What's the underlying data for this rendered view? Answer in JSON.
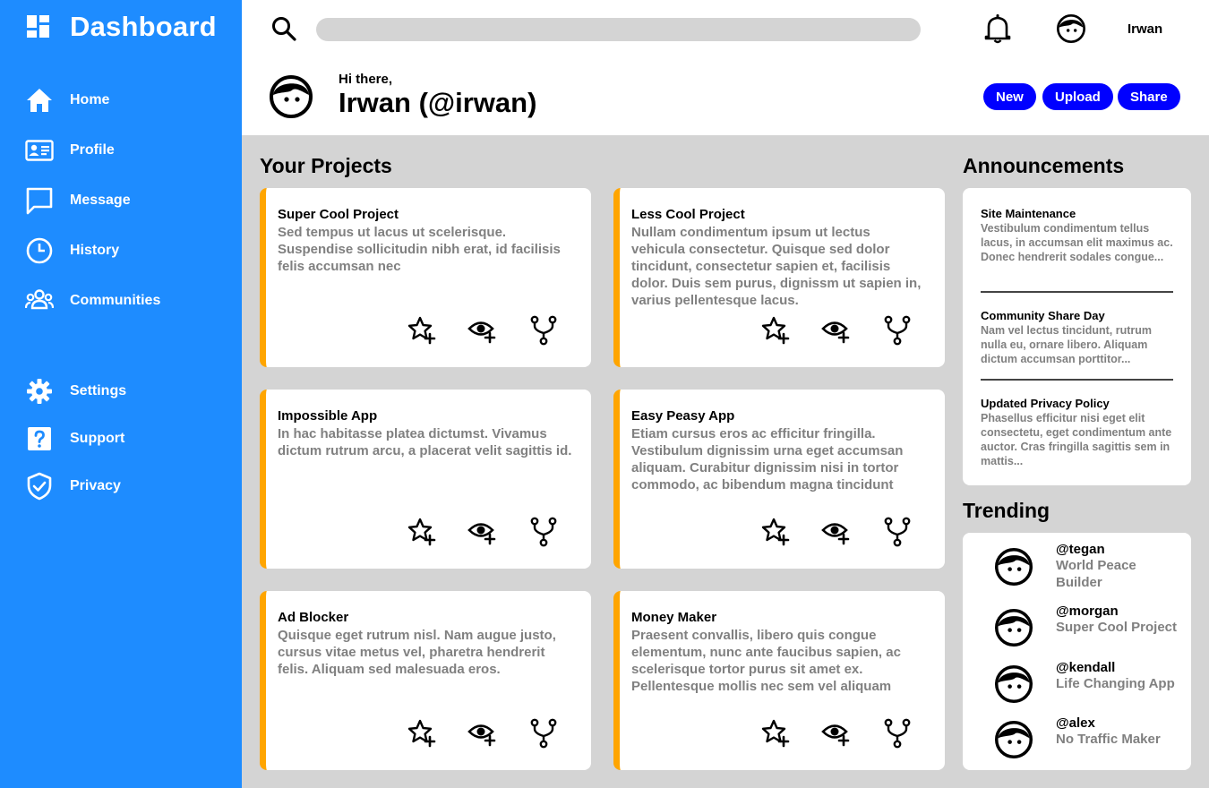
{
  "sidebar": {
    "brand": "Dashboard",
    "brand_icon": "dashboard-grid-icon",
    "items": [
      {
        "label": "Home",
        "icon": "home-icon"
      },
      {
        "label": "Profile",
        "icon": "id-card-icon"
      },
      {
        "label": "Message",
        "icon": "message-icon"
      },
      {
        "label": "History",
        "icon": "clock-icon"
      },
      {
        "label": "Communities",
        "icon": "people-icon"
      },
      {
        "label": "Settings",
        "icon": "gear-icon"
      },
      {
        "label": "Support",
        "icon": "help-icon"
      },
      {
        "label": "Privacy",
        "icon": "shield-icon"
      }
    ]
  },
  "header": {
    "search_placeholder": "",
    "username": "Irwan",
    "greeting": "Hi there,",
    "handle": "Irwan (@irwan)",
    "buttons": {
      "new": "New",
      "upload": "Upload",
      "share": "Share"
    }
  },
  "projects": {
    "title": "Your Projects",
    "cards": [
      {
        "title": "Super Cool Project",
        "description": "Sed tempus ut lacus ut scelerisque. Suspendise sollicitudin nibh erat, id facilisis felis accumsan nec"
      },
      {
        "title": "Less Cool Project",
        "description": "Nullam condimentum ipsum ut lectus vehicula consectetur. Quisque sed dolor tincidunt, consectetur sapien et, facilisis dolor. Duis sem purus, dignissm ut sapien in, varius pellentesque lacus."
      },
      {
        "title": "Impossible App",
        "description": "In hac habitasse platea dictumst. Vivamus dictum rutrum arcu, a placerat velit sagittis id."
      },
      {
        "title": "Easy Peasy App",
        "description": "Etiam cursus eros ac efficitur fringilla. Vestibulum dignissim urna eget accumsan aliquam. Curabitur dignissim nisi in tortor commodo, ac bibendum magna tincidunt"
      },
      {
        "title": "Ad Blocker",
        "description": "Quisque eget rutrum nisl. Nam augue justo, cursus vitae metus vel, pharetra hendrerit felis. Aliquam sed malesuada eros."
      },
      {
        "title": "Money Maker",
        "description": "Praesent convallis, libero quis congue elementum, nunc ante faucibus sapien, ac scelerisque tortor purus sit amet ex. Pellentesque mollis nec sem vel aliquam"
      }
    ],
    "card_actions": [
      "star-add-icon",
      "watch-add-icon",
      "fork-icon"
    ]
  },
  "announcements": {
    "title": "Announcements",
    "items": [
      {
        "title": "Site Maintenance",
        "body": "Vestibulum condimentum tellus lacus, in accumsan elit maximus ac. Donec hendrerit sodales congue..."
      },
      {
        "title": "Community Share Day",
        "body": "Nam vel lectus tincidunt, rutrum nulla eu, ornare libero. Aliquam dictum accumsan porttitor..."
      },
      {
        "title": "Updated Privacy Policy",
        "body": "Phasellus efficitur nisi eget elit consectetu, eget condimentum ante auctor. Cras fringilla sagittis sem in mattis..."
      }
    ]
  },
  "trending": {
    "title": "Trending",
    "items": [
      {
        "user": "@tegan",
        "project": "World Peace Builder"
      },
      {
        "user": "@morgan",
        "project": "Super Cool Project"
      },
      {
        "user": "@kendall",
        "project": "Life Changing App"
      },
      {
        "user": "@alex",
        "project": "No Traffic Maker"
      }
    ]
  },
  "colors": {
    "sidebar": "#1e8cff",
    "accent_button": "#0000ff",
    "card_accent": "#ffa500",
    "background": "#d4d4d4"
  }
}
